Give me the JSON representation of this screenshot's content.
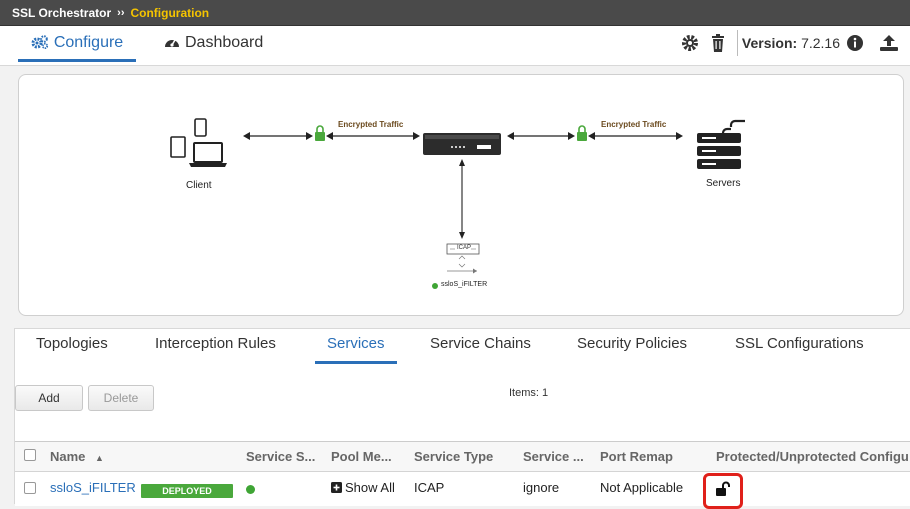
{
  "breadcrumb": {
    "root": "SSL Orchestrator",
    "separator": "››",
    "current": "Configuration"
  },
  "nav": {
    "tabs": [
      {
        "label": "Configure",
        "icon": "cogs-icon",
        "active": true
      },
      {
        "label": "Dashboard",
        "icon": "dashboard-gauge-icon",
        "active": false
      }
    ]
  },
  "toolbar": {
    "version_label": "Version:",
    "version_value": "7.2.16",
    "icons": [
      "gear-icon",
      "trash-icon",
      "info-circle-icon",
      "upload-icon"
    ]
  },
  "topology": {
    "client_label": "Client",
    "servers_label": "Servers",
    "encrypted_left": "Encrypted Traffic",
    "encrypted_right": "Encrypted Traffic",
    "service_box": "ICAP",
    "service_name": "ssloS_iFILTER",
    "status_color": "#3fa535"
  },
  "subtabs": [
    {
      "label": "Topologies",
      "active": false
    },
    {
      "label": "Interception Rules",
      "active": false
    },
    {
      "label": "Services",
      "active": true
    },
    {
      "label": "Service Chains",
      "active": false
    },
    {
      "label": "Security Policies",
      "active": false
    },
    {
      "label": "SSL Configurations",
      "active": false
    }
  ],
  "actions": {
    "add_label": "Add",
    "delete_label": "Delete",
    "items_count": "Items: 1"
  },
  "table": {
    "columns": [
      "Name",
      "Service S...",
      "Pool Me...",
      "Service Type",
      "Service ...",
      "Port Remap",
      "Protected/Unprotected Configu"
    ],
    "sort_indicator": "▲",
    "rows": [
      {
        "name": "ssloS_iFILTER",
        "badge": "DEPLOYED",
        "status": "green",
        "pool_members": "Show All",
        "service_type": "ICAP",
        "service_action": "ignore",
        "port_remap": "Not Applicable",
        "protected": "unlocked-icon"
      }
    ]
  },
  "colors": {
    "accent": "#2a6fb8",
    "breadcrumb_current": "#f5c400",
    "deployed": "#4aa83c",
    "highlight": "#e0201a"
  }
}
